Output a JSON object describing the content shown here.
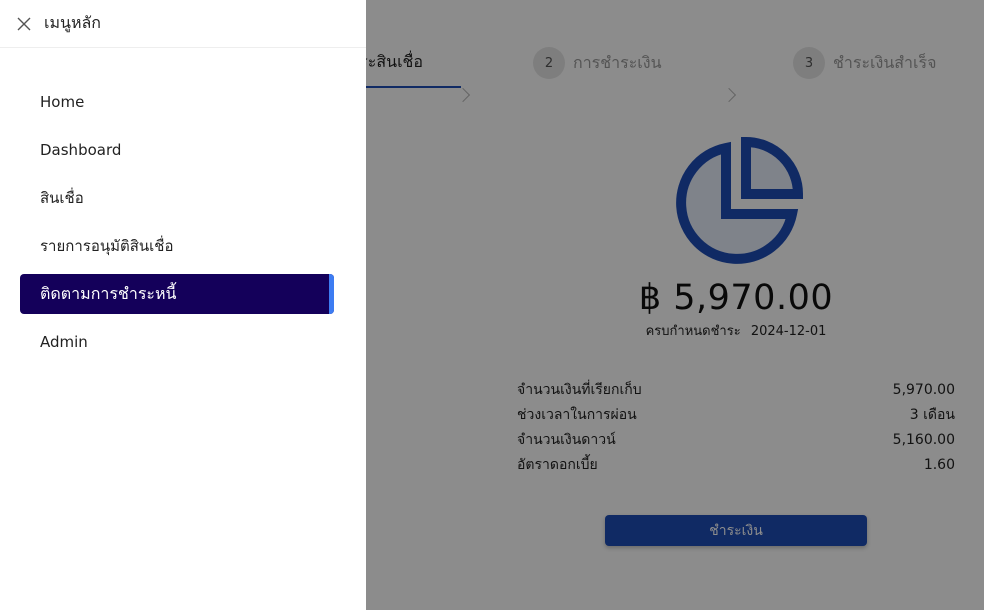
{
  "drawer": {
    "title": "เมนูหลัก",
    "close_icon": "close-icon",
    "menu": [
      {
        "label": "Home",
        "active": false
      },
      {
        "label": "Dashboard",
        "active": false
      },
      {
        "label": "สินเชื่อ",
        "active": false
      },
      {
        "label": "รายการอนุมัติสินเชื่อ",
        "active": false
      },
      {
        "label": "ติดตามการชำระหนี้",
        "active": true
      },
      {
        "label": "Admin",
        "active": false
      }
    ]
  },
  "steps": [
    {
      "number": "",
      "label": "ระสินเชื่อ",
      "active": true
    },
    {
      "number": "2",
      "label": "การชำระเงิน",
      "active": false
    },
    {
      "number": "3",
      "label": "ชำระเงินสำเร็จ",
      "active": false
    }
  ],
  "summary": {
    "pie_icon": "pie-chart-icon",
    "amount": "฿ 5,970.00",
    "due_label": "ครบกำหนดชำระ",
    "due_date": "2024-12-01"
  },
  "details": [
    {
      "label": "จำนวนเงินที่เรียกเก็บ",
      "value": "5,970.00"
    },
    {
      "label": "ช่วงเวลาในการผ่อน",
      "value": "3 เดือน"
    },
    {
      "label": "จำนวนเงินดาวน์",
      "value": "5,160.00"
    },
    {
      "label": "อัตราดอกเบี้ย",
      "value": "1.60"
    }
  ],
  "pay_button": "ชำระเงิน",
  "colors": {
    "primary": "#1e4db7",
    "menu_active_bg": "#14005a",
    "menu_active_accent": "#3d7cf2",
    "overlay": "rgba(0,0,0,0.45)"
  }
}
